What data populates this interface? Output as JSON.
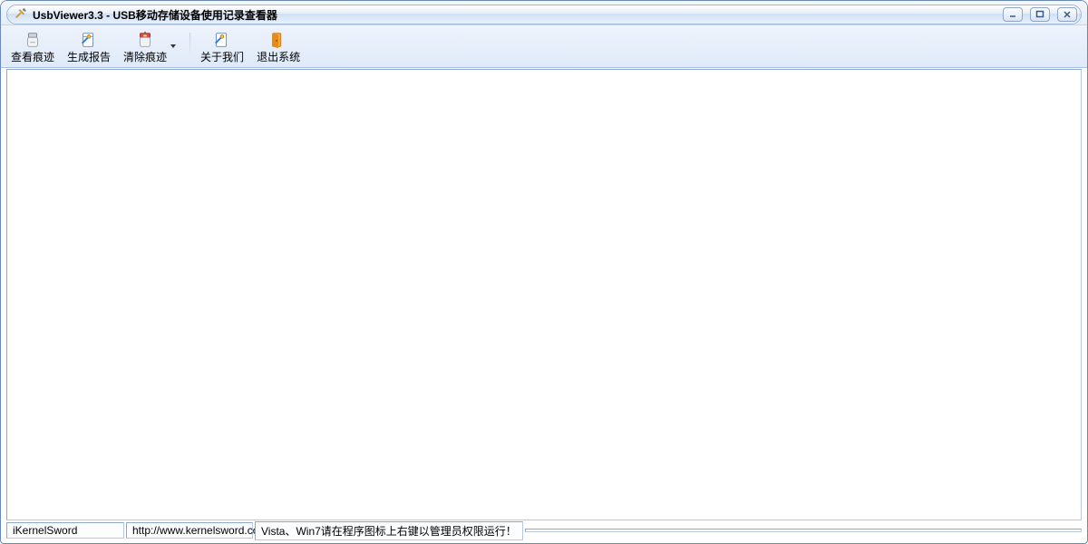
{
  "window": {
    "title": "UsbViewer3.3 - USB移动存储设备使用记录查看器"
  },
  "toolbar": {
    "view_traces": "查看痕迹",
    "generate_report": "生成报告",
    "clear_traces": "清除痕迹",
    "about_us": "关于我们",
    "exit_system": "退出系统"
  },
  "statusbar": {
    "author": "iKernelSword",
    "url": "http://www.kernelsword.com",
    "hint": "Vista、Win7请在程序图标上右键以管理员权限运行！"
  }
}
